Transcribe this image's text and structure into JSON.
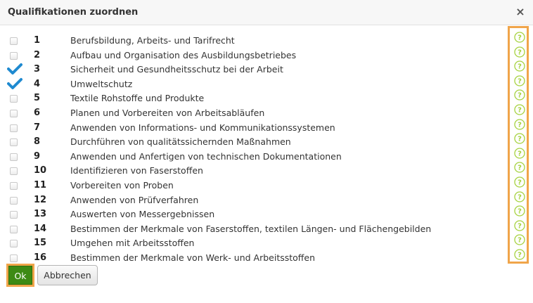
{
  "dialog": {
    "title": "Qualifikationen zuordnen",
    "close_label": "×"
  },
  "items": [
    {
      "num": "1",
      "label": "Berufsbildung, Arbeits- und Tarifrecht",
      "checked": false
    },
    {
      "num": "2",
      "label": "Aufbau und Organisation des Ausbildungsbetriebes",
      "checked": false
    },
    {
      "num": "3",
      "label": "Sicherheit und Gesundheitsschutz bei der Arbeit",
      "checked": true
    },
    {
      "num": "4",
      "label": "Umweltschutz",
      "checked": true
    },
    {
      "num": "5",
      "label": "Textile Rohstoffe und Produkte",
      "checked": false
    },
    {
      "num": "6",
      "label": "Planen und Vorbereiten von Arbeitsabläufen",
      "checked": false
    },
    {
      "num": "7",
      "label": "Anwenden von Informations- und Kommunikationssystemen",
      "checked": false
    },
    {
      "num": "8",
      "label": "Durchführen von qualitätssichernden Maßnahmen",
      "checked": false
    },
    {
      "num": "9",
      "label": "Anwenden und Anfertigen von technischen Dokumentationen",
      "checked": false
    },
    {
      "num": "10",
      "label": "Identifizieren von Faserstoffen",
      "checked": false
    },
    {
      "num": "11",
      "label": "Vorbereiten von Proben",
      "checked": false
    },
    {
      "num": "12",
      "label": "Anwenden von Prüfverfahren",
      "checked": false
    },
    {
      "num": "13",
      "label": "Auswerten von Messergebnissen",
      "checked": false
    },
    {
      "num": "14",
      "label": "Bestimmen der Merkmale von Faserstoffen, textilen Längen- und Flächengebilden",
      "checked": false
    },
    {
      "num": "15",
      "label": "Umgehen mit Arbeitsstoffen",
      "checked": false
    },
    {
      "num": "16",
      "label": "Bestimmen der Merkmale von Werk- und Arbeitsstoffen",
      "checked": false
    }
  ],
  "help_icon": "question-circle-icon",
  "colors": {
    "ok_green": "#3d8a14",
    "check_blue": "#1f8ad0",
    "help_green": "#a6d23f",
    "highlight_orange": "#f0a54a"
  },
  "footer": {
    "ok_label": "Ok",
    "cancel_label": "Abbrechen"
  }
}
